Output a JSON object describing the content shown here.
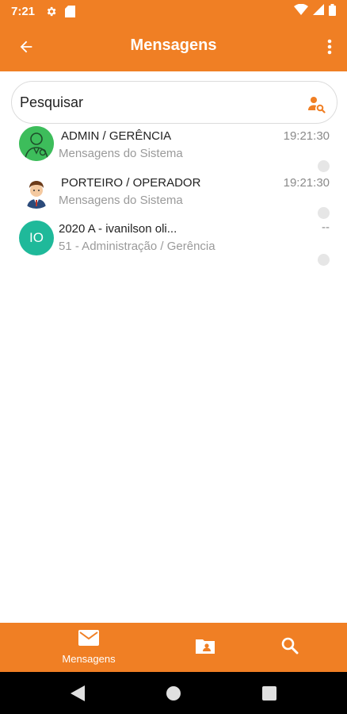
{
  "status_bar": {
    "time": "7:21",
    "icons_left": [
      "gear-icon",
      "sd-card-icon"
    ],
    "icons_right": [
      "wifi-icon",
      "signal-icon",
      "battery-icon"
    ]
  },
  "app_bar": {
    "title": "Mensagens",
    "back_icon": "arrow-back-icon",
    "more_icon": "more-vert-icon"
  },
  "search": {
    "placeholder": "Pesquisar",
    "icon": "user-search-icon"
  },
  "conversations": [
    {
      "name": "ADMIN / GERÊNCIA",
      "subtitle": "Mensagens do Sistema",
      "time": "19:21:30",
      "avatar": "admin-avatar"
    },
    {
      "name": "PORTEIRO / OPERADOR",
      "subtitle": "Mensagens do Sistema",
      "time": "19:21:30",
      "avatar": "porteiro-avatar"
    },
    {
      "name": "2020 A - ivanilson oli...",
      "subtitle": "51 - Administração / Gerência",
      "time": "--",
      "avatar_initials": "IO"
    }
  ],
  "bottom_nav": {
    "items": [
      {
        "label": "Mensagens",
        "icon": "mail-icon",
        "active": true
      },
      {
        "label": "",
        "icon": "contacts-folder-icon",
        "active": false
      },
      {
        "label": "",
        "icon": "search-icon",
        "active": false
      }
    ]
  },
  "colors": {
    "primary": "#f07f24",
    "avatar_admin": "#3dbd5b",
    "avatar_initials": "#1fb99a"
  }
}
